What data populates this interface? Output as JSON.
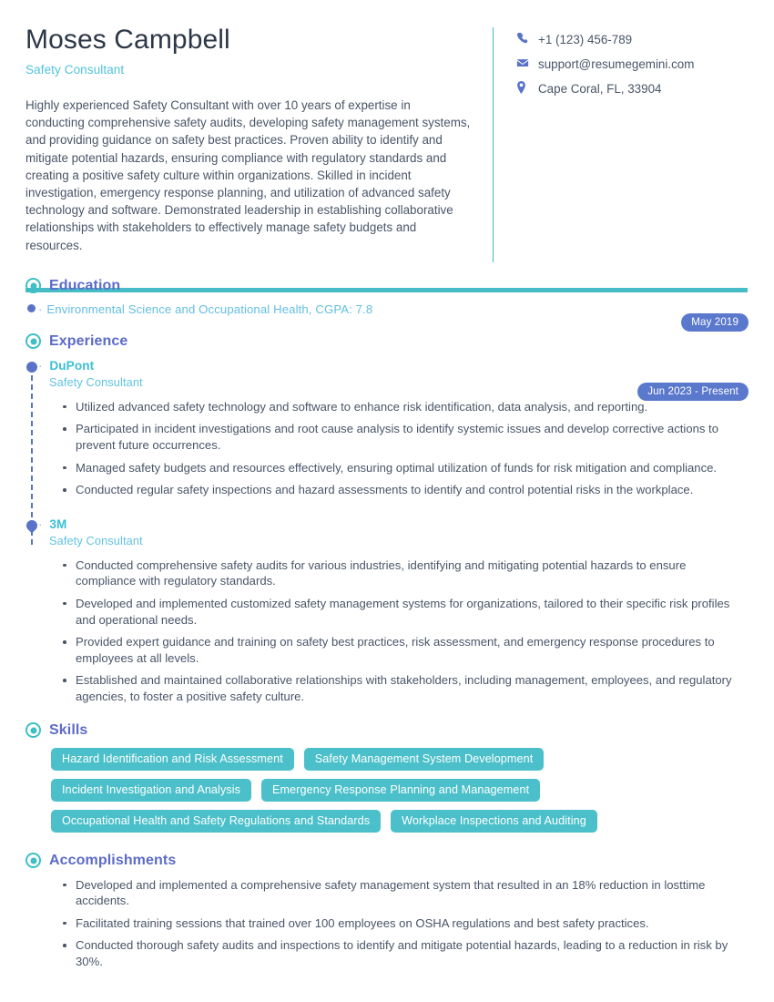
{
  "header": {
    "full_name": "Moses Campbell",
    "job_title": "Safety Consultant",
    "summary": "Highly experienced Safety Consultant with over 10 years of expertise in conducting comprehensive safety audits, developing safety management systems, and providing guidance on safety best practices. Proven ability to identify and mitigate potential hazards, ensuring compliance with regulatory standards and creating a positive safety culture within organizations. Skilled in incident investigation, emergency response planning, and utilization of advanced safety technology and software. Demonstrated leadership in establishing collaborative relationships with stakeholders to effectively manage safety budgets and resources.",
    "contact": [
      {
        "icon": "phone-icon",
        "value": "+1 (123) 456-789"
      },
      {
        "icon": "envelope-icon",
        "value": "support@resumegemini.com"
      },
      {
        "icon": "location-pin-icon",
        "value": "Cape Coral, FL, 33904"
      }
    ]
  },
  "sections": {
    "education": {
      "title": "Education",
      "items": [
        {
          "text": "Environmental Science and Occupational Health, CGPA: 7.8",
          "date": "May 2019"
        }
      ]
    },
    "experience": {
      "title": "Experience",
      "entries": [
        {
          "company": "DuPont",
          "role": "Safety Consultant",
          "date": "Jun 2023 - Present",
          "bullets": [
            "Utilized advanced safety technology and software to enhance risk identification, data analysis, and reporting.",
            "Participated in incident investigations and root cause analysis to identify systemic issues and develop corrective actions to prevent future occurrences.",
            "Managed safety budgets and resources effectively, ensuring optimal utilization of funds for risk mitigation and compliance.",
            "Conducted regular safety inspections and hazard assessments to identify and control potential risks in the workplace."
          ]
        },
        {
          "company": "3M",
          "role": "Safety Consultant",
          "date": "",
          "bullets": [
            "Conducted comprehensive safety audits for various industries, identifying and mitigating potential hazards to ensure compliance with regulatory standards.",
            "Developed and implemented customized safety management systems for organizations, tailored to their specific risk profiles and operational needs.",
            "Provided expert guidance and training on safety best practices, risk assessment, and emergency response procedures to employees at all levels.",
            "Established and maintained collaborative relationships with stakeholders, including management, employees, and regulatory agencies, to foster a positive safety culture."
          ]
        }
      ]
    },
    "skills": {
      "title": "Skills",
      "items": [
        "Hazard Identification and Risk Assessment",
        "Safety Management System Development",
        "Incident Investigation and Analysis",
        "Emergency Response Planning and Management",
        "Occupational Health and Safety Regulations and Standards",
        "Workplace Inspections and Auditing"
      ]
    },
    "accomplishments": {
      "title": "Accomplishments",
      "items": [
        "Developed and implemented a comprehensive safety management system that resulted in an 18% reduction in losttime accidents.",
        "Facilitated training sessions that trained over 100 employees on OSHA regulations and best safety practices.",
        "Conducted thorough safety audits and inspections to identify and mitigate potential hazards, leading to a reduction in risk by 30%."
      ]
    }
  },
  "colors": {
    "teal": "#45bcc6",
    "blue": "#5a73c8",
    "heading_blue": "#5c6bc8",
    "light_blue": "#62bfe0",
    "body_text": "#4a5568"
  }
}
